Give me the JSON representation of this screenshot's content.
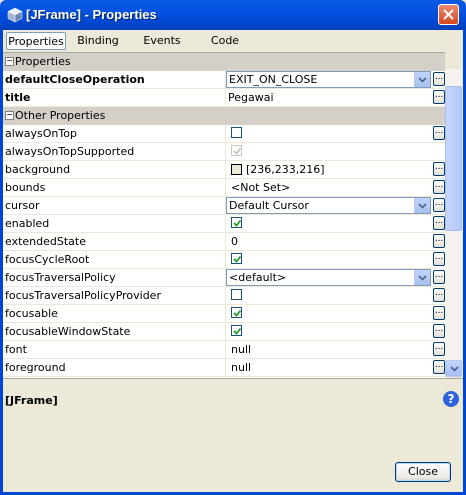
{
  "window": {
    "title": "[JFrame] - Properties",
    "icon": "cube-icon",
    "accent": "#0054E3"
  },
  "tabs": [
    {
      "label": "Properties",
      "selected": true
    },
    {
      "label": "Binding",
      "selected": false
    },
    {
      "label": "Events",
      "selected": false
    },
    {
      "label": "Code",
      "selected": false
    }
  ],
  "sections": {
    "properties": "Properties",
    "other": "Other Properties"
  },
  "rows": {
    "defaultCloseOperation": {
      "name": "defaultCloseOperation",
      "value": "EXIT_ON_CLOSE"
    },
    "title": {
      "name": "title",
      "value": "Pegawai"
    },
    "alwaysOnTop": {
      "name": "alwaysOnTop",
      "checked": false
    },
    "alwaysOnTopSupported": {
      "name": "alwaysOnTopSupported",
      "checked": true
    },
    "background": {
      "name": "background",
      "value": "[236,233,216]",
      "color": "#ECE9D8"
    },
    "bounds": {
      "name": "bounds",
      "value": "<Not Set>"
    },
    "cursor": {
      "name": "cursor",
      "value": "Default Cursor"
    },
    "enabled": {
      "name": "enabled",
      "checked": true
    },
    "extendedState": {
      "name": "extendedState",
      "value": "0"
    },
    "focusCycleRoot": {
      "name": "focusCycleRoot",
      "checked": true
    },
    "focusTraversalPolicy": {
      "name": "focusTraversalPolicy",
      "value": "<default>"
    },
    "focusTraversalPolicyProvider": {
      "name": "focusTraversalPolicyProvider",
      "checked": false
    },
    "focusable": {
      "name": "focusable",
      "checked": true
    },
    "focusableWindowState": {
      "name": "focusableWindowState",
      "checked": true
    },
    "font": {
      "name": "font",
      "value": "null"
    },
    "foreground": {
      "name": "foreground",
      "value": "null"
    }
  },
  "ellipsis_label": "...",
  "description": {
    "title": "[JFrame]",
    "help_label": "?"
  },
  "footer": {
    "close_label": "Close"
  }
}
